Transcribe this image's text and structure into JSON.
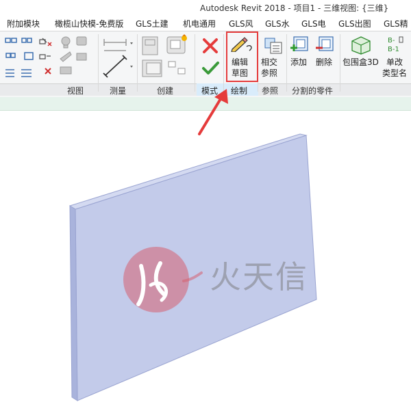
{
  "title": "Autodesk Revit 2018 -    项目1 - 三维视图: {三维}",
  "tabs": [
    "附加模块",
    "橄榄山快模-免费版",
    "GLS土建",
    "机电通用",
    "GLS风",
    "GLS水",
    "GLS电",
    "GLS出图",
    "GLS精"
  ],
  "panels": {
    "view": "视图",
    "measure": "测量",
    "create": "创建",
    "mode": "模式",
    "draw": "绘制",
    "reference": "参照",
    "parts": "分割的零件"
  },
  "buttons": {
    "edit_sketch_line1": "编辑",
    "edit_sketch_line2": "草图",
    "intersect_line1": "相交",
    "intersect_line2": "参照",
    "add": "添加",
    "delete": "删除",
    "bbox3d": "包围盒3D",
    "rename_line1": "单改",
    "rename_line2": "类型名",
    "bb_label": "B-1"
  },
  "watermark": {
    "text": "火天信"
  },
  "colors": {
    "highlight_red": "#e53b3b",
    "panel_blue": "#c3cbea",
    "panel_edge": "#a9b3dc"
  }
}
